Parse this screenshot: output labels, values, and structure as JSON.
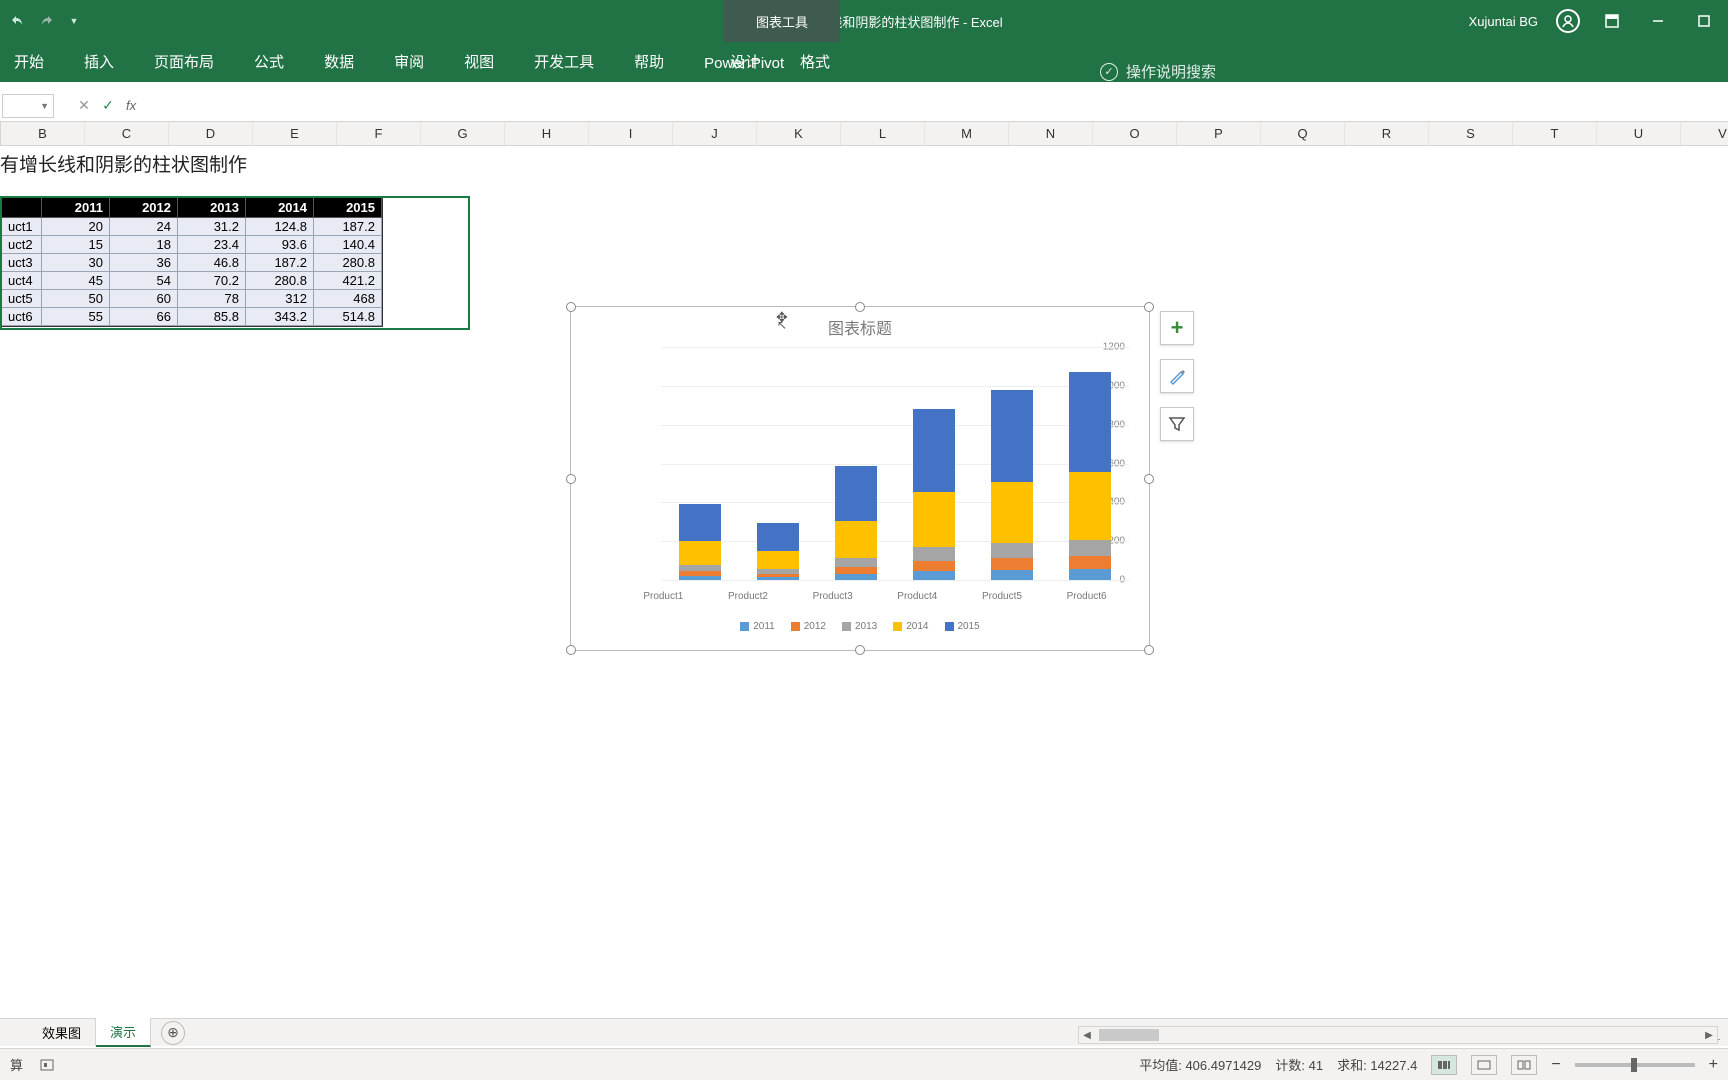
{
  "titlebar": {
    "doc_title": "【作品】带有增长线和阴影的柱状图制作  -  Excel",
    "chart_tools_label": "图表工具",
    "username": "Xujuntai BG"
  },
  "ribbon": {
    "tabs": [
      "开始",
      "插入",
      "页面布局",
      "公式",
      "数据",
      "审阅",
      "视图",
      "开发工具",
      "帮助",
      "Power Pivot"
    ],
    "context_tabs": [
      "设计",
      "格式"
    ],
    "tell_me": "操作说明搜索"
  },
  "formula_bar": {
    "name_box": "",
    "fx_label": "fx",
    "formula": ""
  },
  "columns": [
    "B",
    "C",
    "D",
    "E",
    "F",
    "G",
    "H",
    "I",
    "J",
    "K",
    "L",
    "M",
    "N",
    "O",
    "P",
    "Q",
    "R",
    "S",
    "T",
    "U",
    "V"
  ],
  "sheet_heading": "有增长线和阴影的柱状图制作",
  "table": {
    "headers": [
      "",
      "2011",
      "2012",
      "2013",
      "2014",
      "2015"
    ],
    "rows": [
      [
        "uct1",
        "20",
        "24",
        "31.2",
        "124.8",
        "187.2"
      ],
      [
        "uct2",
        "15",
        "18",
        "23.4",
        "93.6",
        "140.4"
      ],
      [
        "uct3",
        "30",
        "36",
        "46.8",
        "187.2",
        "280.8"
      ],
      [
        "uct4",
        "45",
        "54",
        "70.2",
        "280.8",
        "421.2"
      ],
      [
        "uct5",
        "50",
        "60",
        "78",
        "312",
        "468"
      ],
      [
        "uct6",
        "55",
        "66",
        "85.8",
        "343.2",
        "514.8"
      ]
    ]
  },
  "chart_data": {
    "type": "bar",
    "stacked": true,
    "title": "图表标题",
    "ylim": [
      0,
      1200
    ],
    "yticks": [
      0,
      200,
      400,
      600,
      800,
      1000,
      1200
    ],
    "categories": [
      "Product1",
      "Product2",
      "Product3",
      "Product4",
      "Product5",
      "Product6"
    ],
    "series": [
      {
        "name": "2011",
        "color": "#5b9bd5",
        "values": [
          20,
          15,
          30,
          45,
          50,
          55
        ]
      },
      {
        "name": "2012",
        "color": "#ed7d31",
        "values": [
          24,
          18,
          36,
          54,
          60,
          66
        ]
      },
      {
        "name": "2013",
        "color": "#a5a5a5",
        "values": [
          31.2,
          23.4,
          46.8,
          70.2,
          78,
          85.8
        ]
      },
      {
        "name": "2014",
        "color": "#ffc000",
        "values": [
          124.8,
          93.6,
          187.2,
          280.8,
          312,
          343.2
        ]
      },
      {
        "name": "2015",
        "color": "#4472c4",
        "values": [
          187.2,
          140.4,
          280.8,
          421.2,
          468,
          514.8
        ]
      }
    ]
  },
  "chart_side": {
    "plus": "+"
  },
  "sheet_tabs": {
    "tabs": [
      "效果图",
      "演示"
    ],
    "active": 1
  },
  "statusbar": {
    "mode": "算",
    "avg_label": "平均值: ",
    "avg": "406.4971429",
    "count_label": "计数: ",
    "count": "41",
    "sum_label": "求和: ",
    "sum": "14227.4",
    "zoom_minus": "−",
    "zoom_plus": "+"
  }
}
